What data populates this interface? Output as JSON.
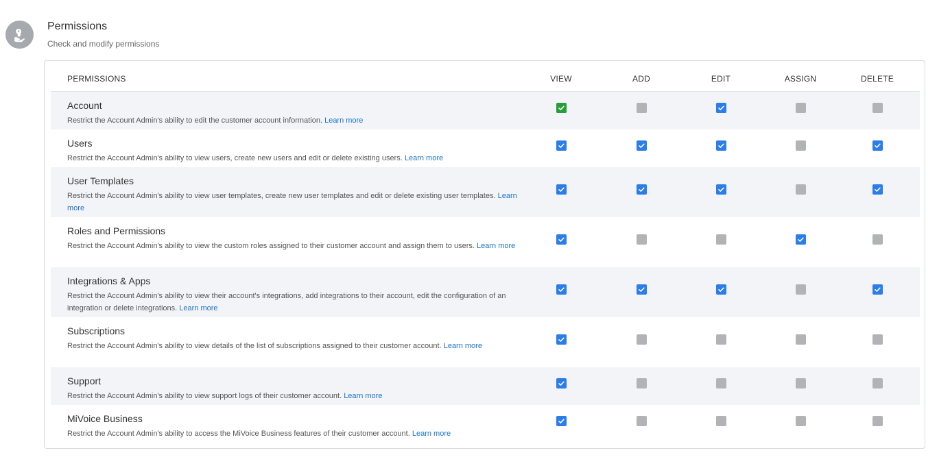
{
  "header": {
    "title": "Permissions",
    "subtitle": "Check and modify permissions",
    "icon": "key-hand-icon"
  },
  "table": {
    "columns": {
      "name": "PERMISSIONS",
      "view": "VIEW",
      "add": "ADD",
      "edit": "EDIT",
      "assign": "ASSIGN",
      "delete": "DELETE"
    },
    "learn_more_label": "Learn more",
    "rows": [
      {
        "title": "Account",
        "description": "Restrict the Account Admin's ability to edit the customer account information.",
        "view": "checked-green",
        "add": "disabled",
        "edit": "checked",
        "assign": "disabled",
        "delete": "disabled"
      },
      {
        "title": "Users",
        "description": "Restrict the Account Admin's ability to view users, create new users and edit or delete existing users.",
        "view": "checked",
        "add": "checked",
        "edit": "checked",
        "assign": "disabled",
        "delete": "checked"
      },
      {
        "title": "User Templates",
        "description": "Restrict the Account Admin's ability to view user templates, create new user templates and edit or delete existing user templates.",
        "view": "checked",
        "add": "checked",
        "edit": "checked",
        "assign": "disabled",
        "delete": "checked"
      },
      {
        "title": "Roles and Permissions",
        "description": "Restrict the Account Admin's ability to view the custom roles assigned to their customer account and assign them to users.",
        "view": "checked",
        "add": "disabled",
        "edit": "disabled",
        "assign": "checked",
        "delete": "disabled"
      },
      {
        "title": "Integrations & Apps",
        "description": "Restrict the Account Admin's ability to view their account's integrations, add integrations to their account, edit the configuration of an integration or delete integrations.",
        "view": "checked",
        "add": "checked",
        "edit": "checked",
        "assign": "disabled",
        "delete": "checked"
      },
      {
        "title": "Subscriptions",
        "description": "Restrict the Account Admin's ability to view details of the list of subscriptions assigned to their customer account.",
        "view": "checked",
        "add": "disabled",
        "edit": "disabled",
        "assign": "disabled",
        "delete": "disabled"
      },
      {
        "title": "Support",
        "description": "Restrict the Account Admin's ability to view support logs of their customer account.",
        "view": "checked",
        "add": "disabled",
        "edit": "disabled",
        "assign": "disabled",
        "delete": "disabled"
      },
      {
        "title": "MiVoice Business",
        "description": "Restrict the Account Admin's ability to access the MiVoice Business features of their customer account.",
        "view": "checked",
        "add": "disabled",
        "edit": "disabled",
        "assign": "disabled",
        "delete": "disabled"
      }
    ]
  },
  "colors": {
    "checked": "#2b7de9",
    "checked_green": "#2a9d3b",
    "disabled": "#b1b3b5",
    "row_shade": "#f2f4f8",
    "link": "#1a73c9"
  }
}
